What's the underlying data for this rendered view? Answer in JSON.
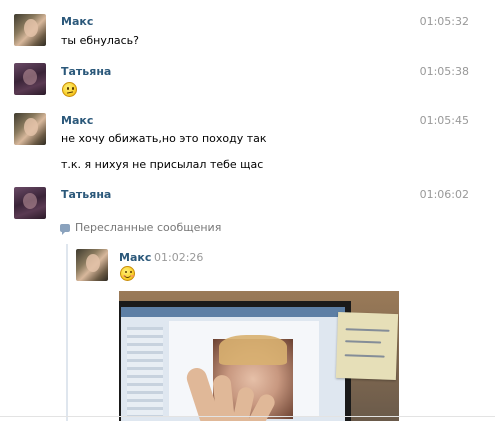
{
  "messages": [
    {
      "author": "Макс",
      "time": "01:05:32",
      "lines": [
        "ты ебнулась?"
      ]
    },
    {
      "author": "Татьяна",
      "time": "01:05:38",
      "emoji": "confused-face-emoji"
    },
    {
      "author": "Макс",
      "time": "01:05:45",
      "lines": [
        "не хочу обижать,но это походу так",
        "т.к. я нихуя не присылал тебе щас"
      ]
    },
    {
      "author": "Татьяна",
      "time": "01:06:02"
    }
  ],
  "forwarded": {
    "header": "Пересланные сообщения",
    "icon": "forward-icon",
    "author": "Макс",
    "time": "01:02:26",
    "emoji": "smiling-blush-emoji",
    "photo_note_text": ""
  },
  "colors": {
    "name": "#2b587a",
    "time": "#999999",
    "accent": "#5d7fa5"
  }
}
